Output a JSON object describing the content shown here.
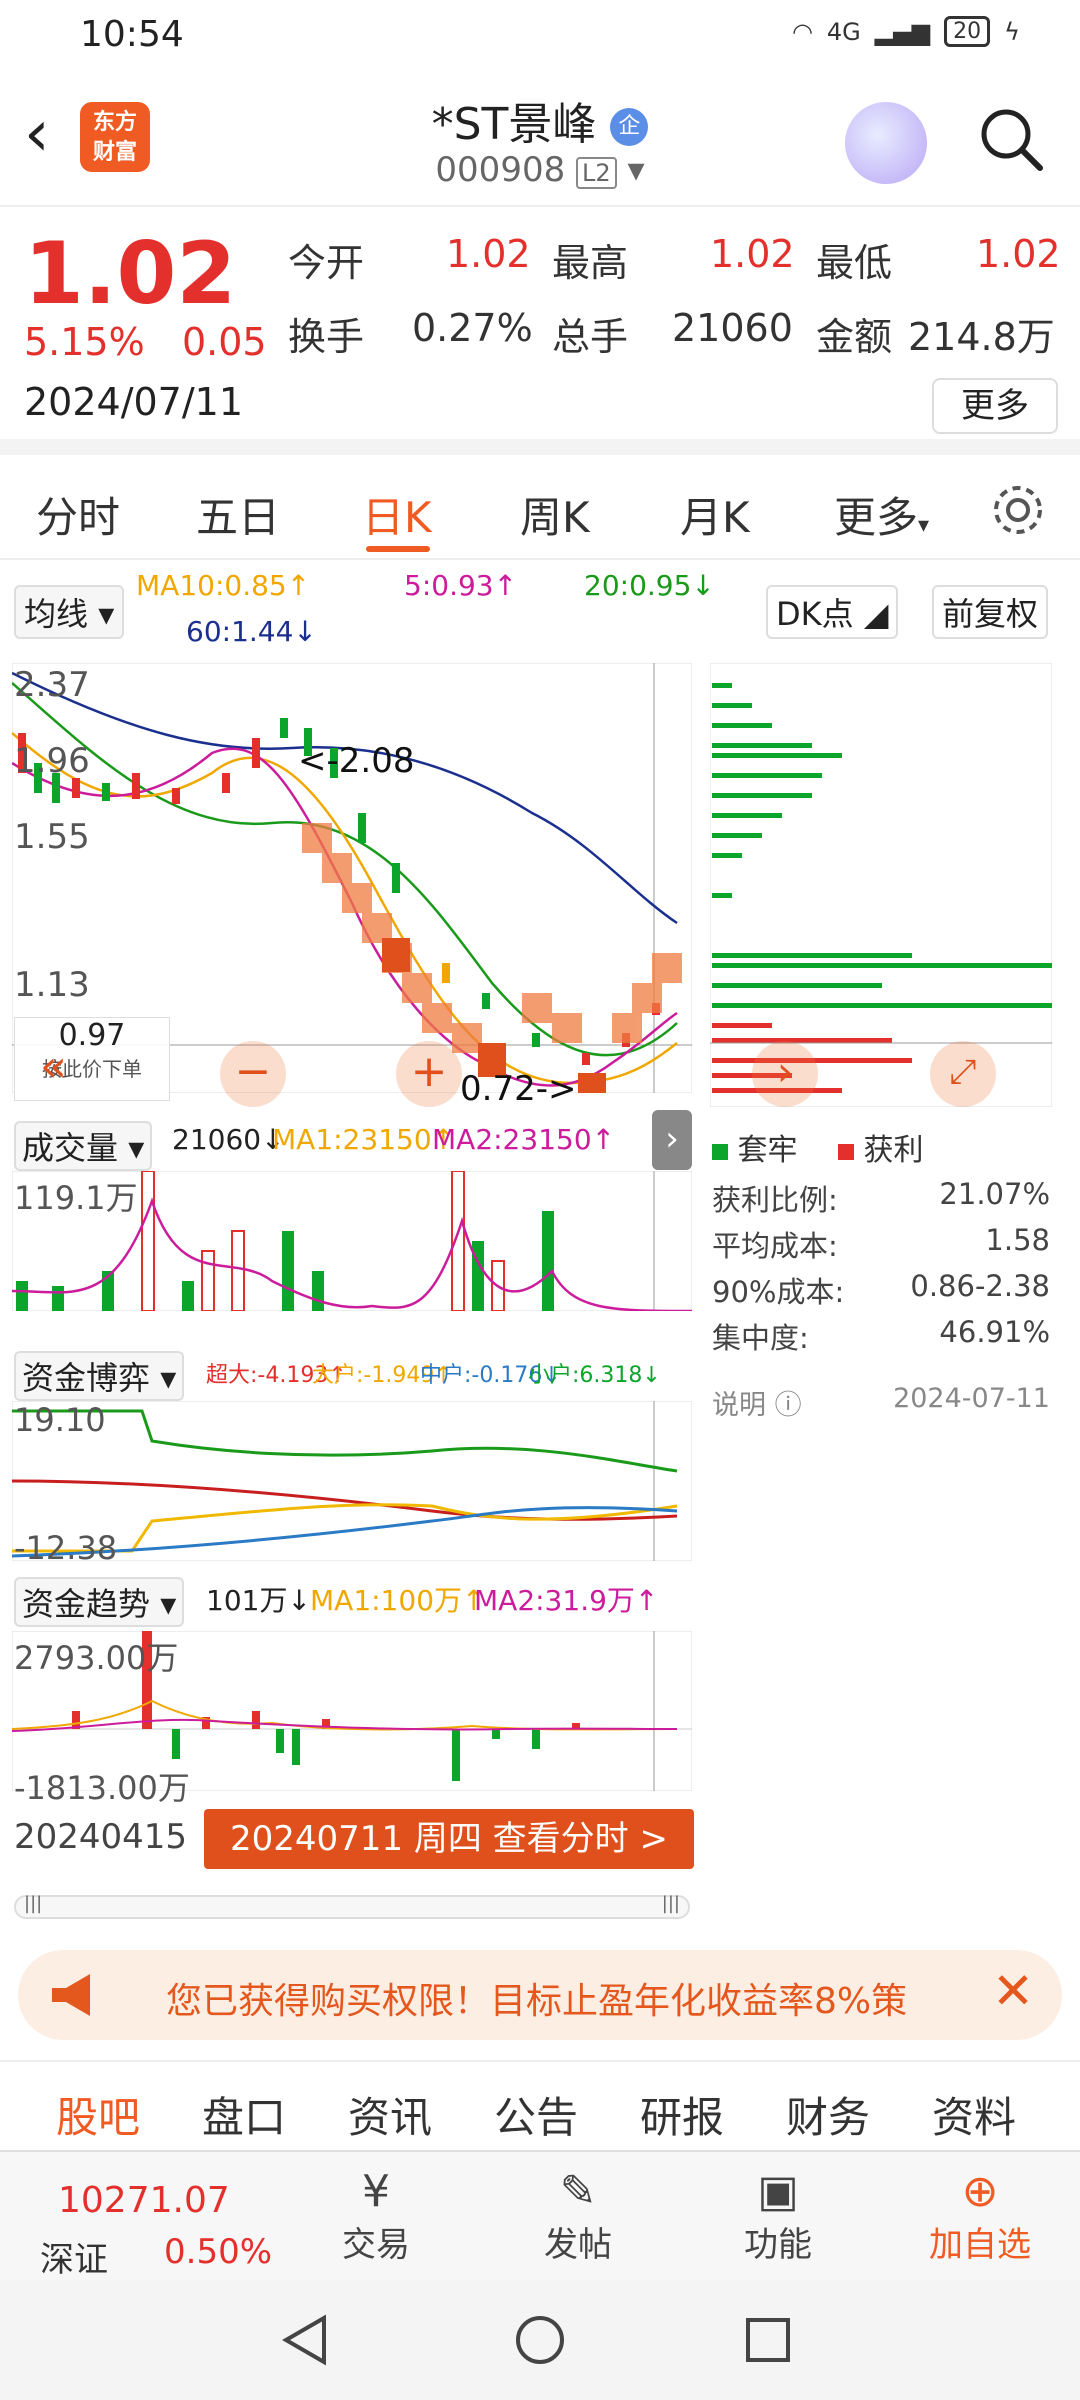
{
  "status_bar": {
    "time": "10:54",
    "network": "4G",
    "battery": "20"
  },
  "header": {
    "logo_text": "东方\n财富",
    "stock_name": "*ST景峰",
    "qi_badge": "企",
    "stock_code": "000908",
    "level": "L2"
  },
  "quote": {
    "price": "1.02",
    "change_pct": "5.15%",
    "change": "0.05",
    "date": "2024/07/11",
    "fields": [
      {
        "label": "今开",
        "value": "1.02"
      },
      {
        "label": "最高",
        "value": "1.02"
      },
      {
        "label": "最低",
        "value": "1.02"
      },
      {
        "label": "换手",
        "value": "0.27%"
      },
      {
        "label": "总手",
        "value": "21060"
      },
      {
        "label": "金额",
        "value": "214.8万"
      }
    ],
    "more_label": "更多"
  },
  "tabs": [
    "分时",
    "五日",
    "日K",
    "周K",
    "月K",
    "更多"
  ],
  "active_tab": "日K",
  "ma_bar": {
    "selector": "均线",
    "ma10": "MA10:0.85↑",
    "ma5": "5:0.93↑",
    "ma20": "20:0.95↓",
    "ma60": "60:1.44↓",
    "dk": "DK点",
    "fuquan": "前复权"
  },
  "kline": {
    "y_labels": [
      "2.37",
      "1.96",
      "1.55",
      "1.13",
      "0.72"
    ],
    "high_note": "<-2.08",
    "low_note": "0.72->",
    "crosshair_price": "0.97",
    "crosshair_hint": "按此价下单",
    "colors": {
      "up": "#e4302c",
      "down": "#0aa52a",
      "ma5": "#cc1c9c",
      "ma10": "#f0a800",
      "ma20": "#1a9a1a",
      "ma60": "#1b2f8f"
    }
  },
  "chip": {
    "legend_trapped": "套牢",
    "legend_profit": "获利",
    "rows": [
      {
        "label": "获利比例:",
        "value": "21.07%"
      },
      {
        "label": "平均成本:",
        "value": "1.58"
      },
      {
        "label": "90%成本:",
        "value": "0.86-2.38"
      },
      {
        "label": "集中度:",
        "value": "46.91%"
      }
    ],
    "note_label": "说明",
    "note_date": "2024-07-11"
  },
  "volume": {
    "selector": "成交量",
    "value": "21060↓",
    "ma1": "MA1:23150↑",
    "ma2": "MA2:23150↑",
    "max_label": "119.1万"
  },
  "fund_game": {
    "selector": "资金博弈",
    "super": "超大:-4.193↑",
    "big": "大户:-1.949↑",
    "mid": "中户:-0.176↓",
    "small": "小户:6.318↓",
    "top": "19.10",
    "bottom": "-12.38"
  },
  "fund_trend": {
    "selector": "资金趋势",
    "value": "101万↓",
    "ma1": "MA1:100万↑",
    "ma2": "MA2:31.9万↑",
    "top": "2793.00万",
    "bottom": "-1813.00万"
  },
  "dates": {
    "start": "20240415",
    "current": "20240711 周四 查看分时 >"
  },
  "notice": {
    "text": "您已获得购买权限！目标止盈年化收益率8%策"
  },
  "bottom_tabs": [
    "股吧",
    "盘口",
    "资讯",
    "公告",
    "研报",
    "财务",
    "资料"
  ],
  "bottom_bar": {
    "index_value": "10271.07",
    "index_name": "深证",
    "index_pct": "0.50%",
    "trade": "交易",
    "post": "发帖",
    "function": "功能",
    "add": "加自选"
  }
}
